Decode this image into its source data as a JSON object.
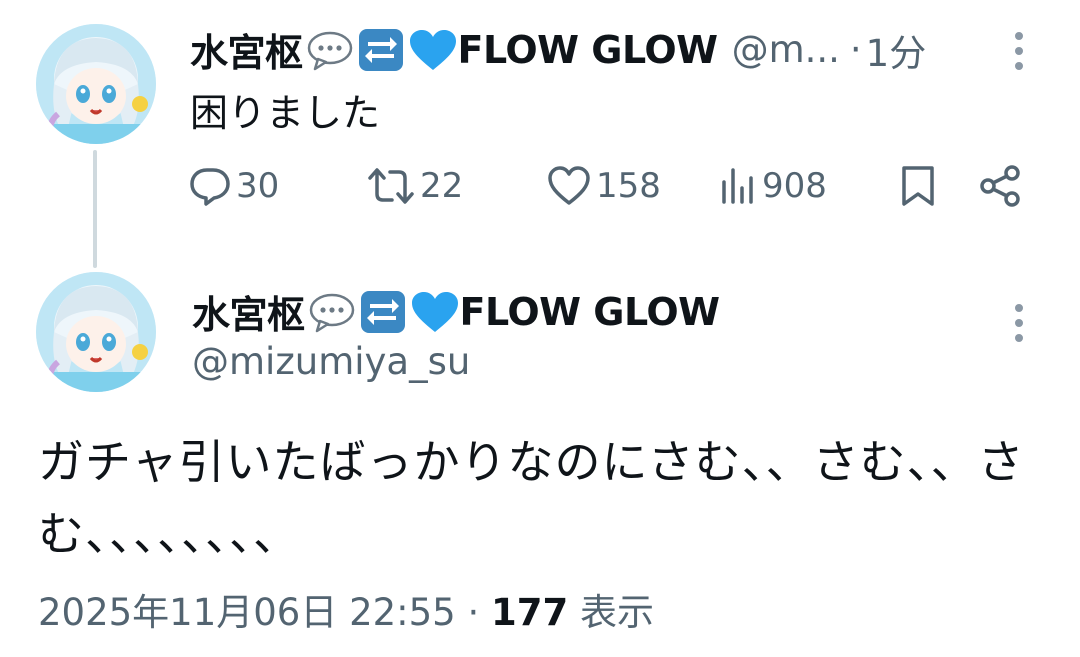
{
  "reply_tweet": {
    "display_name": "水宮枢",
    "display_name_suffix": "FLOW GLOW",
    "handle_truncated": "@m...",
    "time_separator": "·",
    "time": "1分",
    "text": "困りました",
    "stats": {
      "replies": "30",
      "retweets": "22",
      "likes": "158",
      "views": "908"
    }
  },
  "main_tweet": {
    "display_name": "水宮枢",
    "display_name_suffix": "FLOW GLOW",
    "handle": "@mizumiya_su",
    "text": "ガチャ引いたばっかりなのにさむ、、さむ、、さむ、、、、、、、、",
    "date": "2025年11月06日 22:55",
    "meta_separator": "·",
    "view_count": "177",
    "view_label": "表示"
  },
  "colors": {
    "text_primary": "#0f1419",
    "text_secondary": "#536471",
    "thread_line": "#cfd9de",
    "heart_emoji": "#2aa3ef",
    "repeat_emoji": "#3b88c3"
  },
  "icons": {
    "emoji_1": "speech-balloon-emoji",
    "emoji_2": "repeat-emoji",
    "emoji_3": "blue-heart-emoji",
    "reply": "reply-icon",
    "retweet": "retweet-icon",
    "like": "heart-icon",
    "views": "views-chart-icon",
    "bookmark": "bookmark-icon",
    "share": "share-icon",
    "more": "more-vertical-icon"
  }
}
